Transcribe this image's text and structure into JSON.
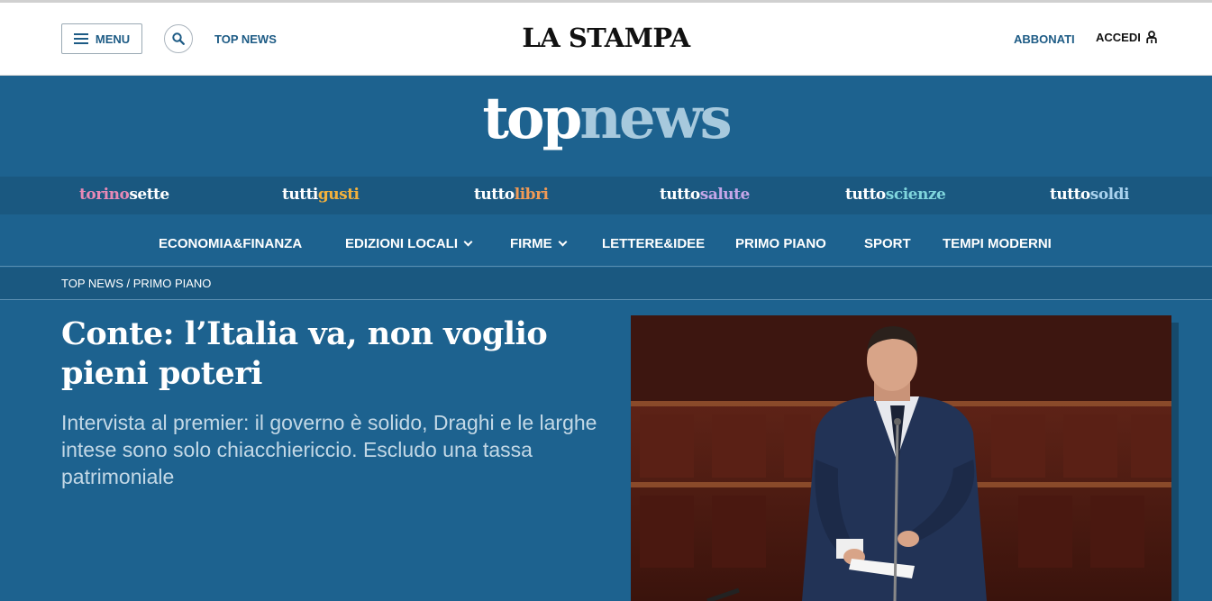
{
  "header": {
    "menu_label": "MENU",
    "top_news_link": "TOP NEWS",
    "logo_text": "LA STAMPA",
    "subscribe_label": "ABBONATI",
    "login_label": "ACCEDI"
  },
  "brand": {
    "part1": "top",
    "part2": "news"
  },
  "sub_brands": [
    {
      "a": "torino",
      "b": "sette"
    },
    {
      "a": "tutti",
      "b": "gusti"
    },
    {
      "a": "tutto",
      "b": "libri"
    },
    {
      "a": "tutto",
      "b": "salute"
    },
    {
      "a": "tutto",
      "b": "scienze"
    },
    {
      "a": "tutto",
      "b": "soldi"
    }
  ],
  "nav": [
    {
      "label": "ECONOMIA&FINANZA"
    },
    {
      "label": "EDIZIONI LOCALI"
    },
    {
      "label": "FIRME"
    },
    {
      "label": "LETTERE&IDEE"
    },
    {
      "label": "PRIMO PIANO"
    },
    {
      "label": "SPORT"
    },
    {
      "label": "TEMPI MODERNI"
    }
  ],
  "breadcrumb": {
    "items": [
      "TOP NEWS",
      "PRIMO PIANO"
    ],
    "separator": " / "
  },
  "article": {
    "headline": "Conte: l’Italia va, non voglio pieni poteri",
    "standfirst": "Intervista al premier: il governo è solido, Draghi e le larghe intese sono solo chiacchiericcio. Escludo una tassa patrimoniale"
  },
  "icons": {
    "menu": "hamburger-icon",
    "search": "search-icon",
    "user": "user-icon",
    "dropdown": "chevron-down-icon"
  },
  "colors": {
    "brand_blue": "#1d628f",
    "dark_blue": "#1a5880",
    "link_blue": "#1d5b85",
    "light_blue": "#a7c9dd"
  }
}
